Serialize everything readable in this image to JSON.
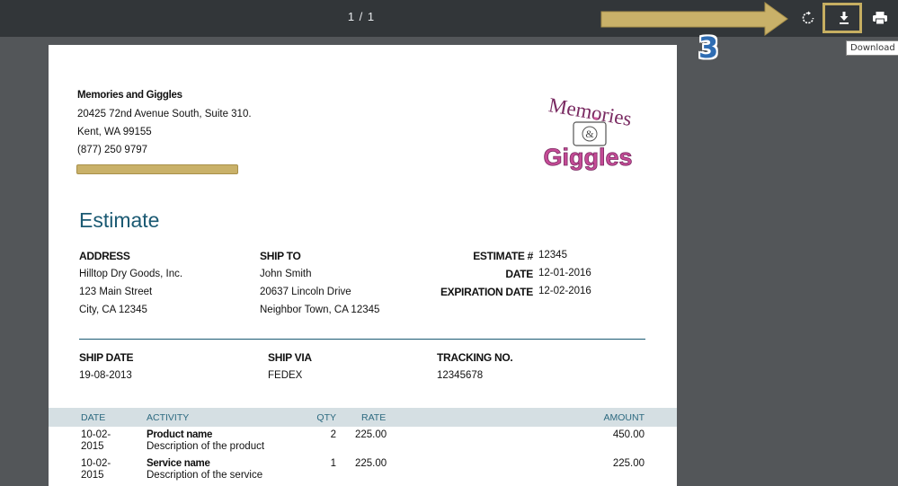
{
  "toolbar": {
    "page_counter": "1 / 1",
    "rotate_icon": "rotate-icon",
    "download_icon": "download-icon",
    "print_icon": "print-icon",
    "tooltip": "Download",
    "step_number": "3"
  },
  "colors": {
    "highlight": "#c6ae61",
    "accent": "#1b5a73",
    "step": "#2f6db3"
  },
  "company": {
    "name": "Memories and Giggles",
    "address1": "20425 72nd Avenue South, Suite 310.",
    "address2": "Kent, WA  99155",
    "phone": "(877) 250 9797"
  },
  "logo": {
    "line1": "Memories",
    "amp": "&",
    "line2": "Giggles"
  },
  "estimate": {
    "title": "Estimate",
    "address": {
      "label": "ADDRESS",
      "line1": "Hilltop Dry Goods, Inc.",
      "line2": "123 Main Street",
      "line3": "City, CA 12345"
    },
    "ship_to": {
      "label": "SHIP TO",
      "line1": "John Smith",
      "line2": "20637 Lincoln Drive",
      "line3": "Neighbor Town, CA 12345"
    },
    "meta": {
      "number_label": "ESTIMATE #",
      "number": "12345",
      "date_label": "DATE",
      "date": "12-01-2016",
      "exp_label": "EXPIRATION DATE",
      "exp": "12-02-2016"
    },
    "shipping": {
      "date_label": "SHIP DATE",
      "date": "19-08-2013",
      "via_label": "SHIP VIA",
      "via": "FEDEX",
      "tracking_label": "TRACKING NO.",
      "tracking": "12345678"
    },
    "table": {
      "headers": {
        "date": "DATE",
        "activity": "ACTIVITY",
        "qty": "QTY",
        "rate": "RATE",
        "amount": "AMOUNT"
      },
      "rows": [
        {
          "date1": "10-02-",
          "date2": "2015",
          "name": "Product name",
          "desc": "Description of the product",
          "qty": "2",
          "rate": "225.00",
          "amount": "450.00"
        },
        {
          "date1": "10-02-",
          "date2": "2015",
          "name": "Service name",
          "desc": "Description of the service",
          "qty": "1",
          "rate": "225.00",
          "amount": "225.00"
        }
      ]
    }
  }
}
